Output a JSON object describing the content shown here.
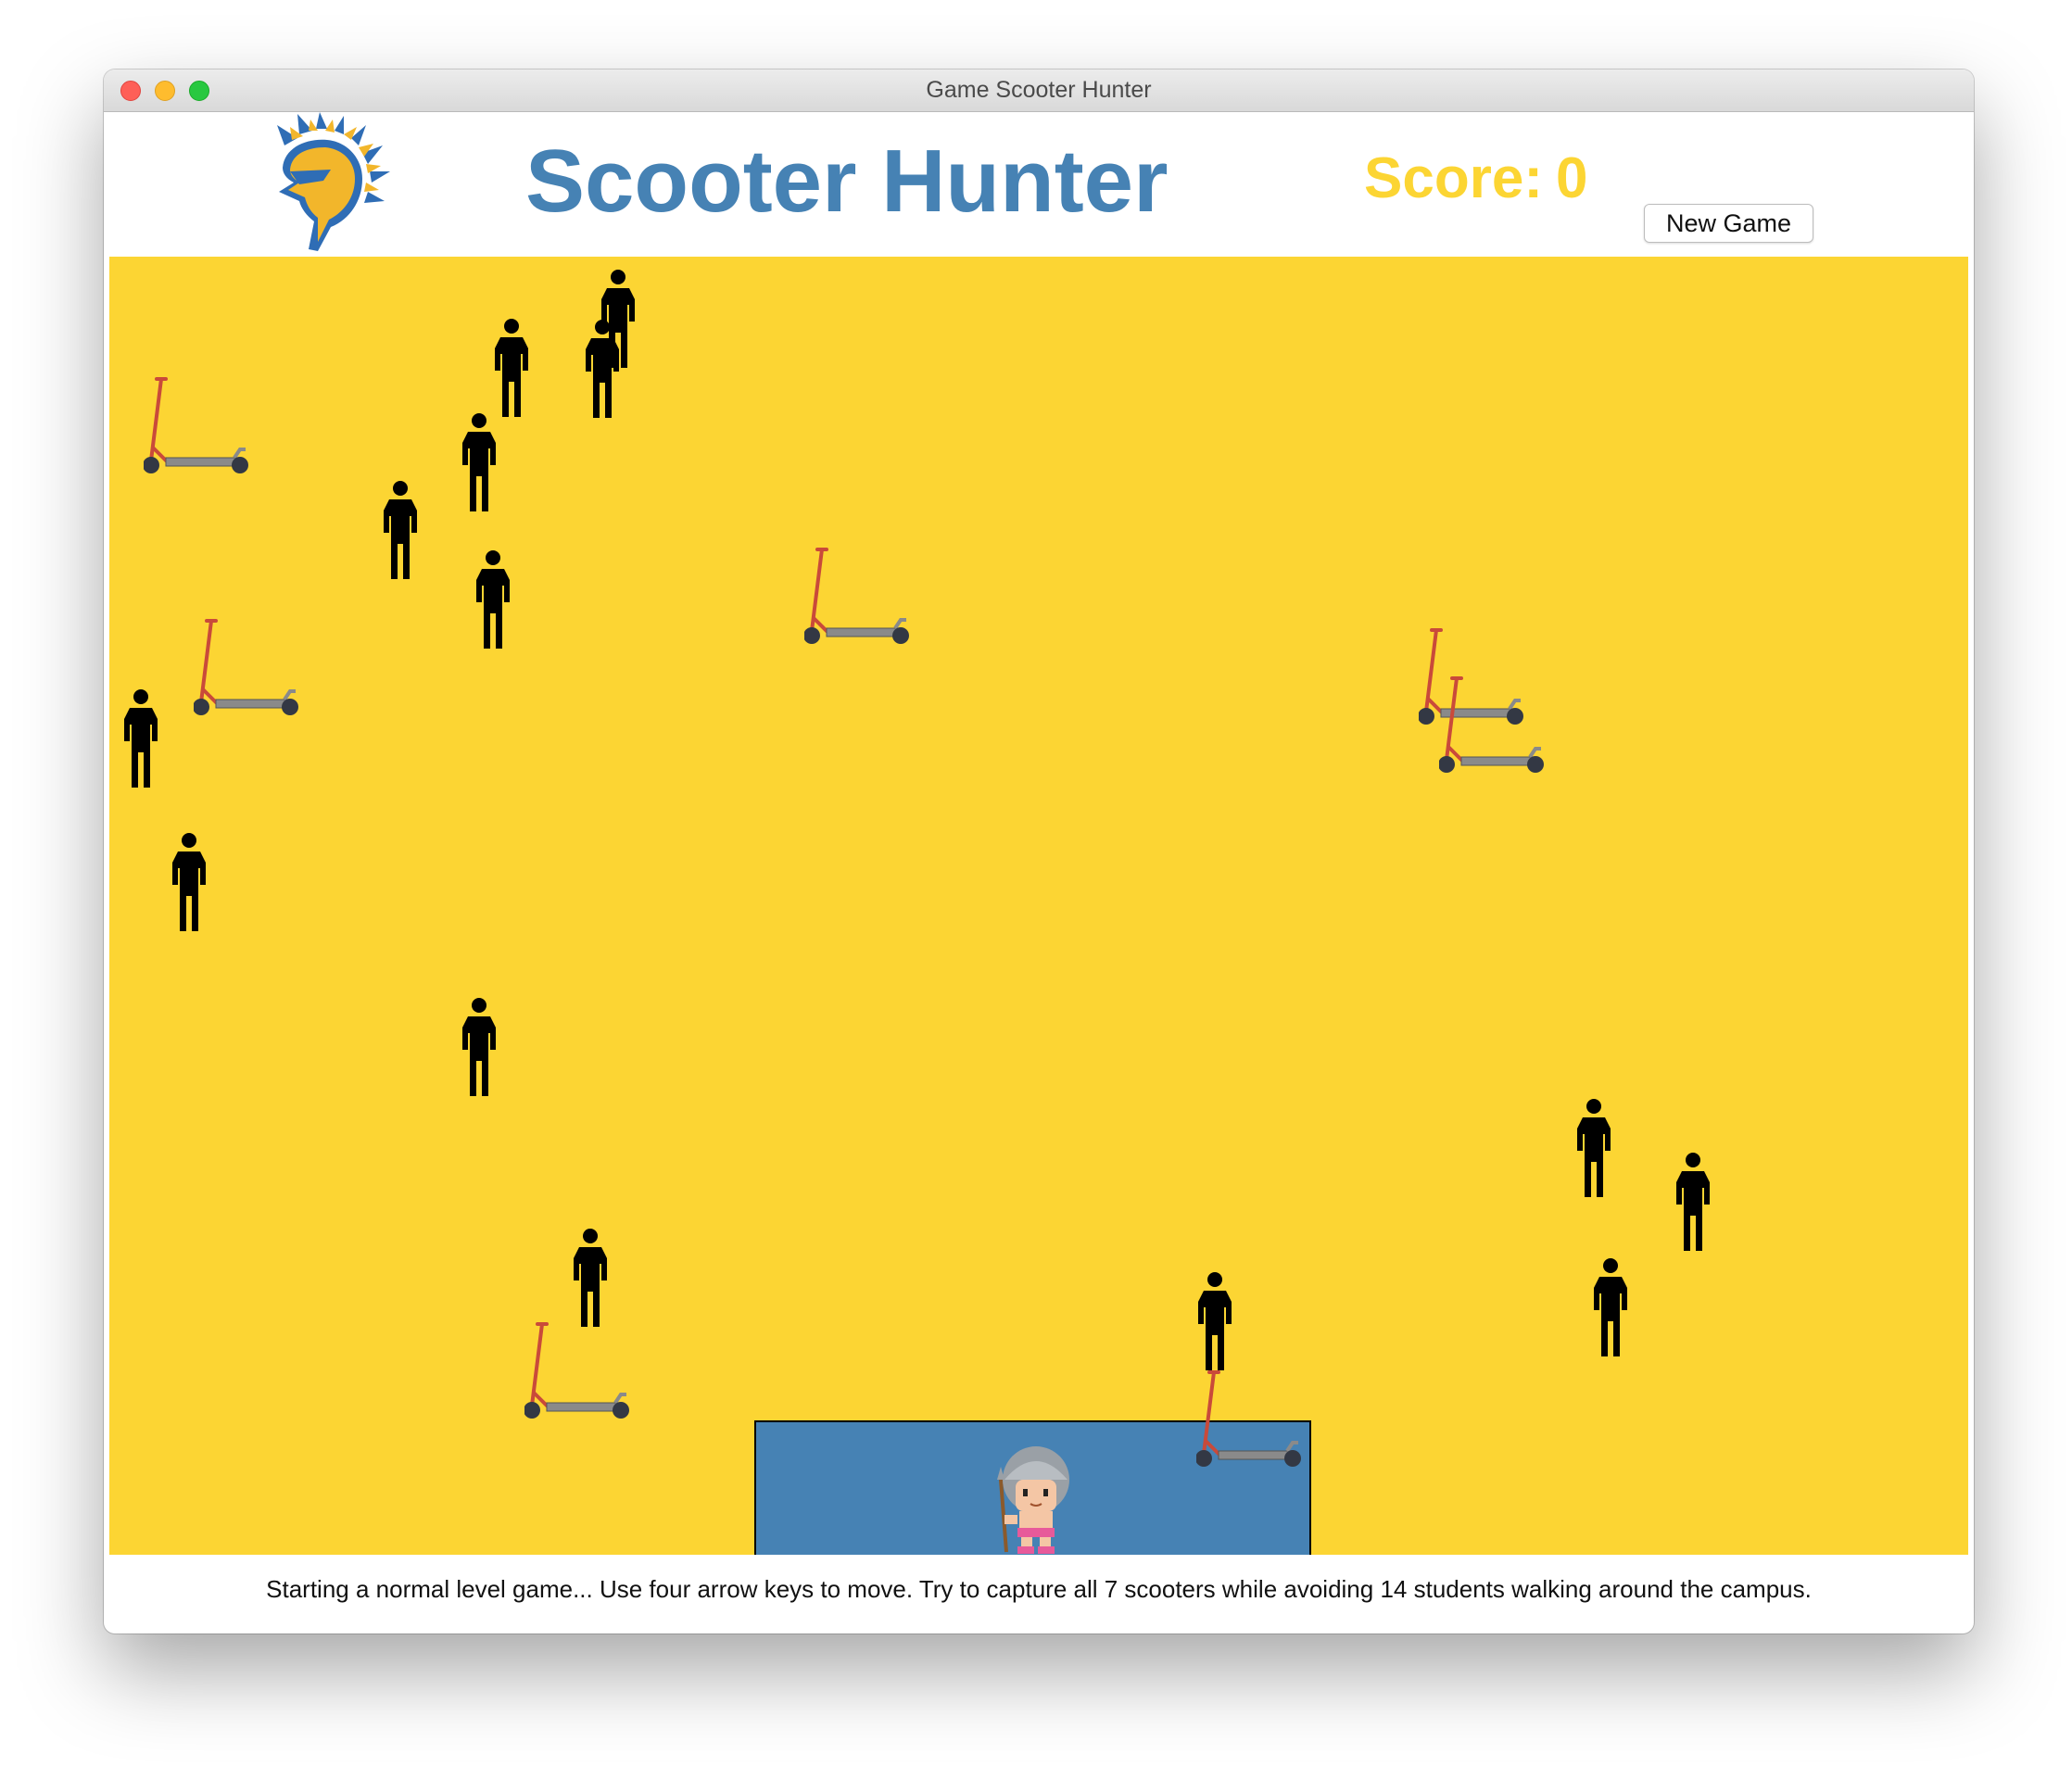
{
  "window": {
    "title": "Game Scooter Hunter"
  },
  "header": {
    "title": "Scooter Hunter",
    "score_label": "Score:",
    "score_value": "0",
    "new_game_label": "New Game"
  },
  "status": {
    "message": "Starting a normal level game... Use four arrow keys to move. Try to capture all 7 scooters while avoiding 14 students walking around the campus."
  },
  "game": {
    "scooters_total": 7,
    "students_total": 14
  },
  "colors": {
    "field": "#fcd533",
    "title": "#4682b4",
    "score": "#fcd533",
    "base": "#4682b4",
    "student": "#000000",
    "scooter_stem": "#c94a3a",
    "scooter_deck": "#8a8a8a"
  },
  "icons": {
    "logo": "spartan-helmet-icon",
    "student": "student-icon",
    "scooter": "scooter-icon",
    "player": "player-warrior-icon"
  }
}
